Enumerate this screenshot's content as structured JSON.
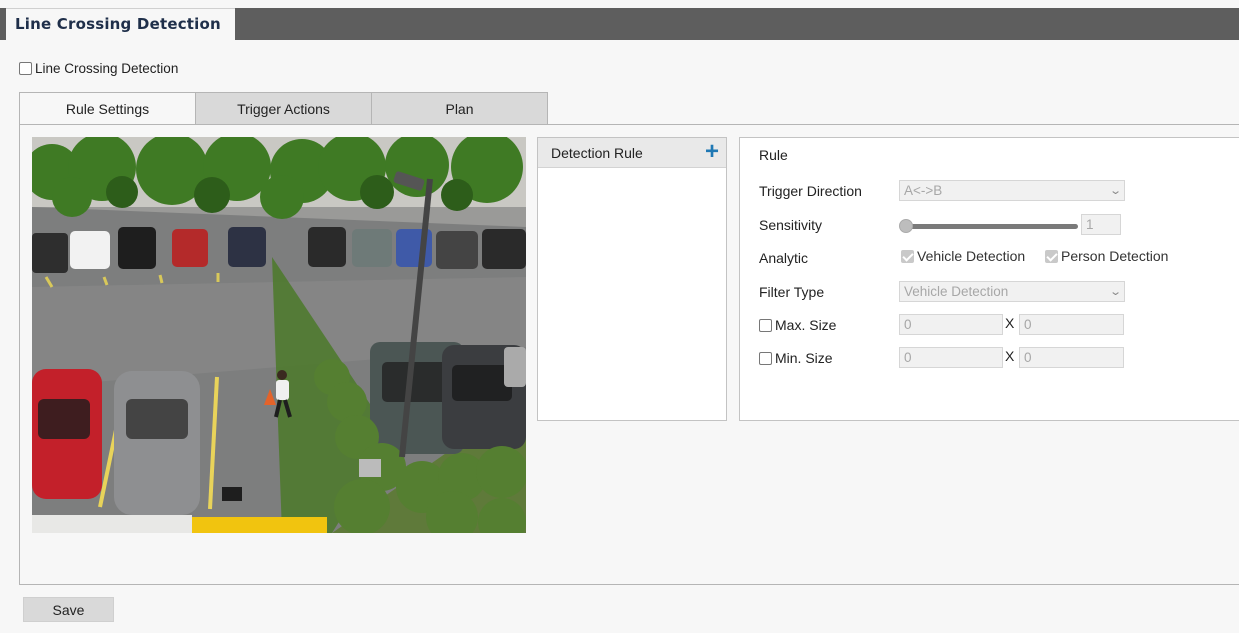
{
  "header": {
    "title": "Line Crossing Detection"
  },
  "enable": {
    "label": "Line Crossing Detection",
    "checked": false
  },
  "tabs": [
    {
      "label": "Rule Settings",
      "active": true
    },
    {
      "label": "Trigger Actions",
      "active": false
    },
    {
      "label": "Plan",
      "active": false
    }
  ],
  "rule_list": {
    "header": "Detection Rule",
    "add_icon": "plus-icon"
  },
  "rule": {
    "title": "Rule",
    "trigger_direction": {
      "label": "Trigger Direction",
      "value": "A<->B"
    },
    "sensitivity": {
      "label": "Sensitivity",
      "value": "1"
    },
    "analytic": {
      "label": "Analytic",
      "vehicle": "Vehicle Detection",
      "person": "Person Detection"
    },
    "filter_type": {
      "label": "Filter Type",
      "value": "Vehicle Detection"
    },
    "max_size": {
      "label": "Max. Size",
      "w": "0",
      "h": "0",
      "sep": "X"
    },
    "min_size": {
      "label": "Min. Size",
      "w": "0",
      "h": "0",
      "sep": "X"
    }
  },
  "save_label": "Save",
  "colors": {
    "title_bar": "#5e5e5e",
    "accent": "#1f78b4"
  }
}
